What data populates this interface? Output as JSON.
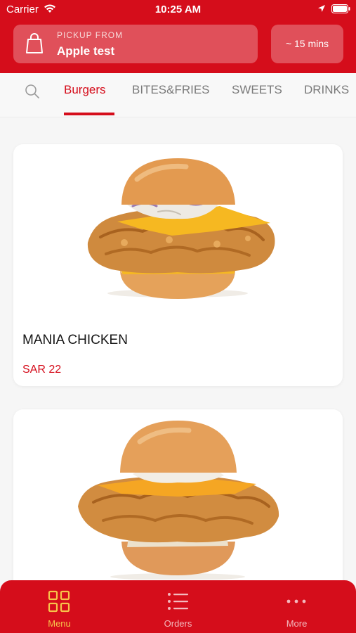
{
  "status_bar": {
    "carrier": "Carrier",
    "time": "10:25 AM"
  },
  "pickup": {
    "label": "PICKUP FROM",
    "store": "Apple test",
    "eta": "~ 15 mins"
  },
  "categories": [
    {
      "label": "Burgers",
      "active": true
    },
    {
      "label": "BITES&FRIES",
      "active": false
    },
    {
      "label": "SWEETS",
      "active": false
    },
    {
      "label": "DRINKS",
      "active": false
    }
  ],
  "products": [
    {
      "name": "MANIA CHICKEN",
      "price": "SAR 22"
    },
    {
      "name": "",
      "price": ""
    }
  ],
  "tab_bar": {
    "items": [
      {
        "label": "Menu",
        "icon": "grid-icon",
        "active": true
      },
      {
        "label": "Orders",
        "icon": "list-icon",
        "active": false
      },
      {
        "label": "More",
        "icon": "dots-icon",
        "active": false
      }
    ]
  },
  "colors": {
    "brand_red": "#d50d1b",
    "active_tab": "#f7c34a"
  }
}
